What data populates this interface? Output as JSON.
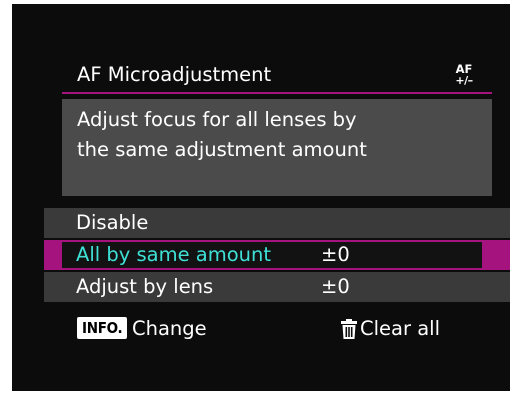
{
  "header": {
    "title": "AF Microadjustment",
    "icon_name": "af-microadjust-icon",
    "icon_top": "AF",
    "icon_bottom": "+/–"
  },
  "description": {
    "line1": "Adjust focus for all lenses by",
    "line2": "the same adjustment amount"
  },
  "menu": {
    "items": [
      {
        "label": "Disable",
        "value": ""
      },
      {
        "label": "All by same amount",
        "value": "±0"
      },
      {
        "label": "Adjust by lens",
        "value": "±0"
      }
    ],
    "selected_index": 1
  },
  "footer": {
    "info_badge": "INFO.",
    "info_action": "Change",
    "trash_icon": "trash-icon",
    "clear_action": "Clear all"
  },
  "colors": {
    "accent": "#a4137e",
    "selected_text": "#3fe0d6",
    "background": "#0c0c0c",
    "panel": "#4b4b4b",
    "menu_row": "#3a3a3a"
  }
}
